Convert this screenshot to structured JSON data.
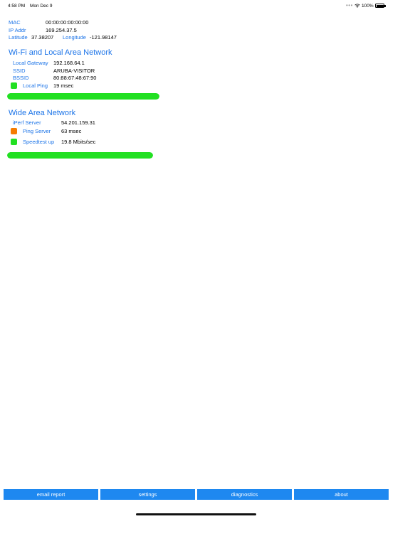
{
  "status_bar": {
    "time": "4:58 PM",
    "date": "Mon Dec 9",
    "dots": "•••",
    "battery": "100%",
    "icons": [
      "wifi-icon",
      "battery-icon"
    ]
  },
  "device": {
    "mac_label": "MAC",
    "mac_value": "00:00:00:00:00:00",
    "ip_label": "IP Addr",
    "ip_value": "169.254.37.5",
    "lat_label": "Latitude",
    "lat_value": "37.38207",
    "lon_label": "Longitude",
    "lon_value": "-121.98147"
  },
  "lan": {
    "title": "Wi-Fi and Local Area Network",
    "gateway_label": "Local Gateway",
    "gateway_value": "192.168.64.1",
    "ssid_label": "SSID",
    "ssid_value": "ARUBA-VISITOR",
    "bssid_label": "BSSID",
    "bssid_value": "80:88:67:48:67:90",
    "ping_label": "Local Ping",
    "ping_value": "19 msec",
    "ping_status_color": "#22e022",
    "progress_fraction": 1.0,
    "progress_color": "#22e022"
  },
  "wan": {
    "title": "Wide Area Network",
    "iperf_label": "iPerf Server",
    "iperf_value": "54.201.159.31",
    "ping_label": "Ping Server",
    "ping_value": "63 msec",
    "ping_status_color": "#f57c00",
    "speed_label": "Speedtest up",
    "speed_value": "19.8 Mbits/sec",
    "speed_status_color": "#22e022",
    "progress_fraction": 1.0,
    "progress_color": "#22e022"
  },
  "toolbar": {
    "email_report": "email report",
    "settings": "settings",
    "diagnostics": "diagnostics",
    "about": "about",
    "button_color": "#1e88f0"
  }
}
